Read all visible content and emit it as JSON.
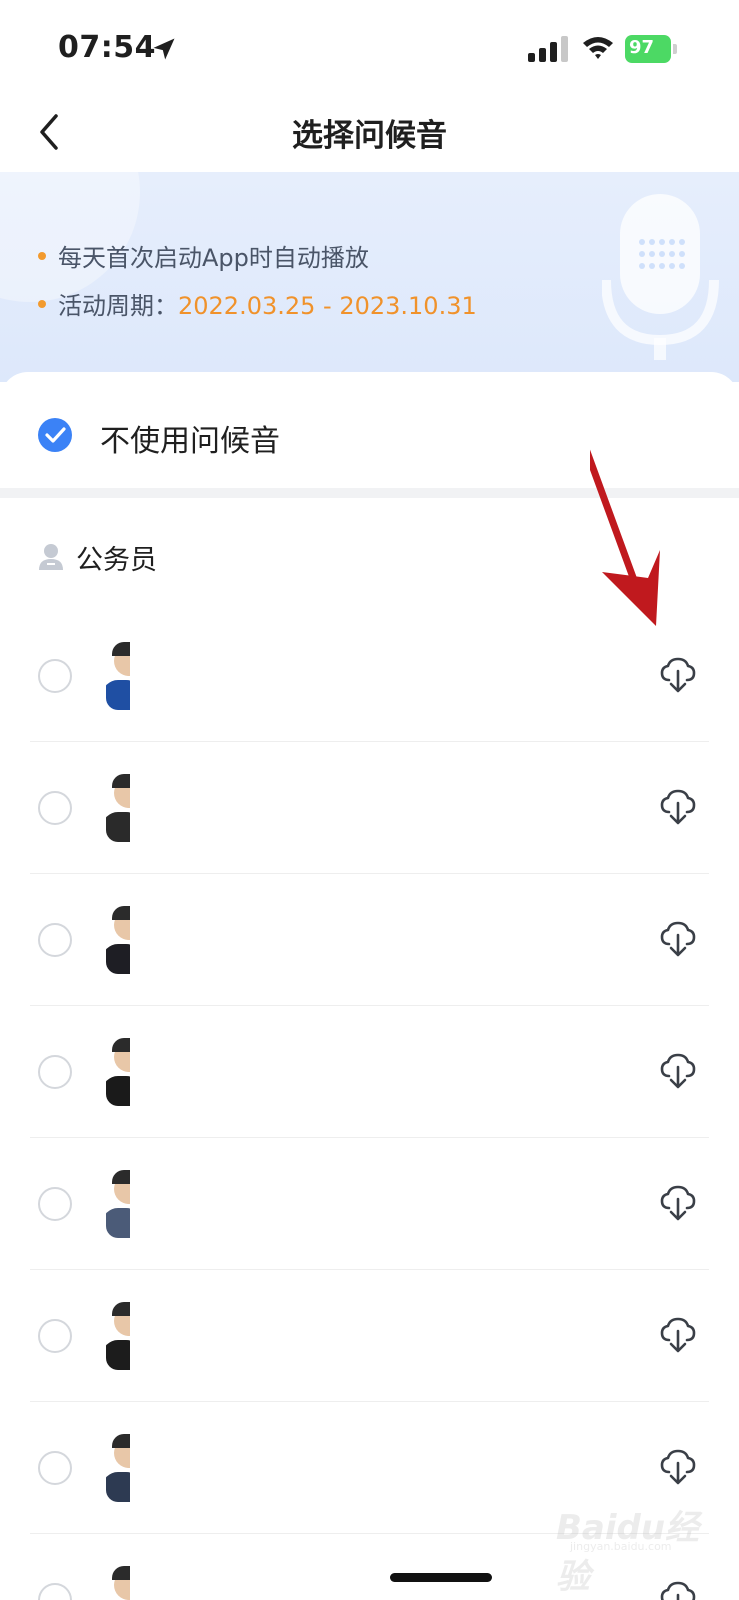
{
  "status_bar": {
    "time": "07:54",
    "battery": "97"
  },
  "nav": {
    "title": "选择问候音"
  },
  "banner": {
    "line1": "每天首次启动App时自动播放",
    "period_label": "活动周期：",
    "period_value": "2022.03.25 - 2023.10.31"
  },
  "options": {
    "no_greeting_label": "不使用问候音",
    "no_greeting_checked": true
  },
  "section": {
    "title": "公务员"
  },
  "list": {
    "items": [
      {
        "name": "",
        "selected": false,
        "icon": "download-cloud-icon",
        "suit_color": "#1f4fa3"
      },
      {
        "name": "",
        "selected": false,
        "icon": "download-cloud-icon",
        "suit_color": "#2a2a2a"
      },
      {
        "name": "",
        "selected": false,
        "icon": "download-cloud-icon",
        "suit_color": "#1e1e24"
      },
      {
        "name": "",
        "selected": false,
        "icon": "download-cloud-icon",
        "suit_color": "#1a1a1a"
      },
      {
        "name": "",
        "selected": false,
        "icon": "download-cloud-icon",
        "suit_color": "#4b5b78"
      },
      {
        "name": "",
        "selected": false,
        "icon": "download-cloud-icon",
        "suit_color": "#1c1c1c"
      },
      {
        "name": "",
        "selected": false,
        "icon": "download-cloud-icon",
        "suit_color": "#2d3a52"
      },
      {
        "name": "",
        "selected": false,
        "icon": "download-cloud-icon",
        "suit_color": "#2a2a2a"
      }
    ]
  },
  "colors": {
    "accent_blue": "#3b82f6",
    "accent_orange": "#f0922b",
    "annotation_red": "#c0191e"
  },
  "watermark": {
    "text": "Baidu经验",
    "sub": "jingyan.baidu.com"
  }
}
